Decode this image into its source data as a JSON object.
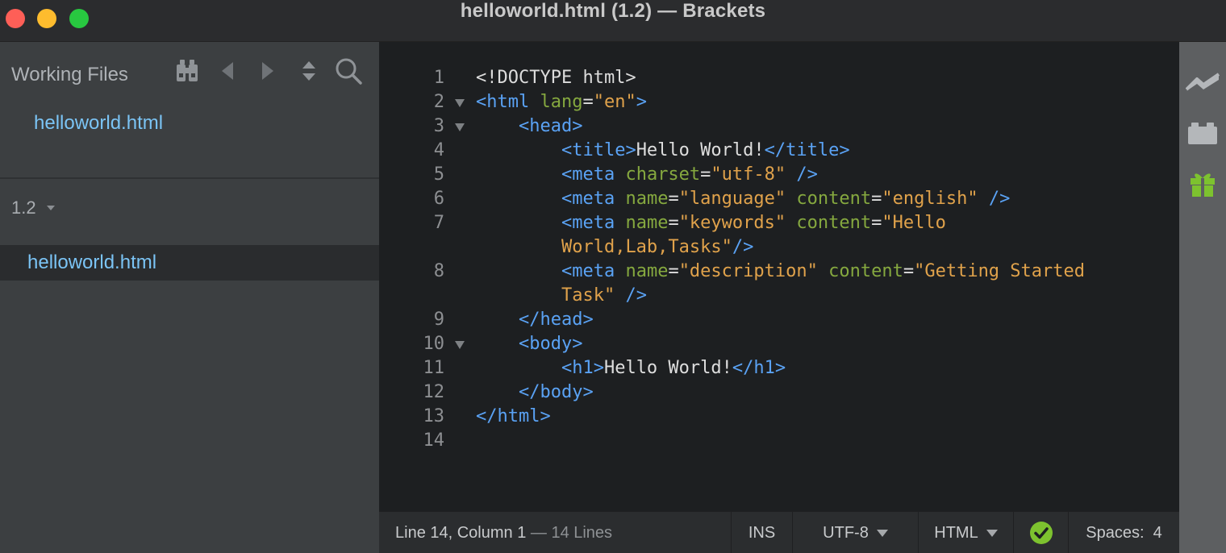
{
  "window": {
    "title": "helloworld.html (1.2) — Brackets"
  },
  "sidebar": {
    "working_files_title": "Working Files",
    "working_files": [
      "helloworld.html"
    ],
    "project_name": "1.2",
    "tree_items": [
      "helloworld.html"
    ]
  },
  "editor": {
    "lines": [
      {
        "num": "1",
        "tokens": [
          [
            "doc",
            "<!DOCTYPE html>"
          ]
        ]
      },
      {
        "num": "2",
        "fold": true,
        "tokens": [
          [
            "tag",
            "<html"
          ],
          [
            "txt",
            " "
          ],
          [
            "attr",
            "lang"
          ],
          [
            "txt",
            "="
          ],
          [
            "str",
            "\"en\""
          ],
          [
            "tag",
            ">"
          ]
        ]
      },
      {
        "num": "3",
        "fold": true,
        "tokens": [
          [
            "txt",
            "    "
          ],
          [
            "tag",
            "<head>"
          ]
        ]
      },
      {
        "num": "4",
        "tokens": [
          [
            "txt",
            "        "
          ],
          [
            "tag",
            "<title>"
          ],
          [
            "txt",
            "Hello World!"
          ],
          [
            "tag",
            "</title>"
          ]
        ]
      },
      {
        "num": "5",
        "tokens": [
          [
            "txt",
            "        "
          ],
          [
            "tag",
            "<meta"
          ],
          [
            "txt",
            " "
          ],
          [
            "attr",
            "charset"
          ],
          [
            "txt",
            "="
          ],
          [
            "str",
            "\"utf-8\""
          ],
          [
            "txt",
            " "
          ],
          [
            "tag",
            "/>"
          ]
        ]
      },
      {
        "num": "6",
        "tokens": [
          [
            "txt",
            "        "
          ],
          [
            "tag",
            "<meta"
          ],
          [
            "txt",
            " "
          ],
          [
            "attr",
            "name"
          ],
          [
            "txt",
            "="
          ],
          [
            "str",
            "\"language\""
          ],
          [
            "txt",
            " "
          ],
          [
            "attr",
            "content"
          ],
          [
            "txt",
            "="
          ],
          [
            "str",
            "\"english\""
          ],
          [
            "txt",
            " "
          ],
          [
            "tag",
            "/>"
          ]
        ]
      },
      {
        "num": "7",
        "tokens": [
          [
            "txt",
            "        "
          ],
          [
            "tag",
            "<meta"
          ],
          [
            "txt",
            " "
          ],
          [
            "attr",
            "name"
          ],
          [
            "txt",
            "="
          ],
          [
            "str",
            "\"keywords\""
          ],
          [
            "txt",
            " "
          ],
          [
            "attr",
            "content"
          ],
          [
            "txt",
            "="
          ],
          [
            "str",
            "\"Hello"
          ]
        ]
      },
      {
        "num": "",
        "tokens": [
          [
            "txt",
            "        "
          ],
          [
            "str",
            "World,Lab,Tasks\""
          ],
          [
            "tag",
            "/>"
          ]
        ]
      },
      {
        "num": "8",
        "tokens": [
          [
            "txt",
            "        "
          ],
          [
            "tag",
            "<meta"
          ],
          [
            "txt",
            " "
          ],
          [
            "attr",
            "name"
          ],
          [
            "txt",
            "="
          ],
          [
            "str",
            "\"description\""
          ],
          [
            "txt",
            " "
          ],
          [
            "attr",
            "content"
          ],
          [
            "txt",
            "="
          ],
          [
            "str",
            "\"Getting Started"
          ]
        ]
      },
      {
        "num": "",
        "tokens": [
          [
            "txt",
            "        "
          ],
          [
            "str",
            "Task\""
          ],
          [
            "txt",
            " "
          ],
          [
            "tag",
            "/>"
          ]
        ]
      },
      {
        "num": "9",
        "tokens": [
          [
            "txt",
            "    "
          ],
          [
            "tag",
            "</head>"
          ]
        ]
      },
      {
        "num": "10",
        "fold": true,
        "tokens": [
          [
            "txt",
            "    "
          ],
          [
            "tag",
            "<body>"
          ]
        ]
      },
      {
        "num": "11",
        "tokens": [
          [
            "txt",
            "        "
          ],
          [
            "tag",
            "<h1>"
          ],
          [
            "txt",
            "Hello World!"
          ],
          [
            "tag",
            "</h1>"
          ]
        ]
      },
      {
        "num": "12",
        "tokens": [
          [
            "txt",
            "    "
          ],
          [
            "tag",
            "</body>"
          ]
        ]
      },
      {
        "num": "13",
        "tokens": [
          [
            "tag",
            "</html>"
          ]
        ]
      },
      {
        "num": "14",
        "tokens": []
      }
    ]
  },
  "statusbar": {
    "position": "Line 14, Column 1",
    "lines": " — 14 Lines",
    "mode": "INS",
    "encoding": "UTF-8",
    "language": "HTML",
    "spaces_label": "Spaces:",
    "spaces_value": "4",
    "lint_color": "#7dc22f"
  },
  "toolbar_icons": [
    "live-preview-icon",
    "extension-manager-icon",
    "gift-icon"
  ],
  "sidebar_icons": [
    "binoculars-icon",
    "back-arrow-icon",
    "forward-arrow-icon",
    "sort-icon",
    "search-icon"
  ]
}
